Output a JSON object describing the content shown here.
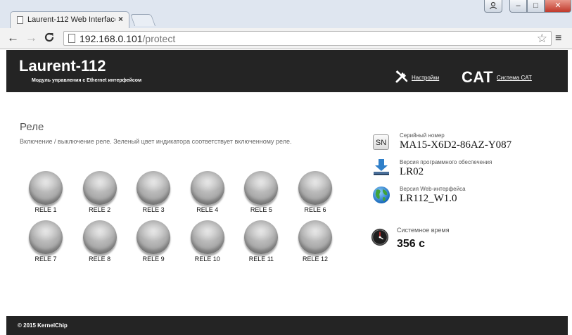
{
  "browser": {
    "tab_title": "Laurent-112 Web Interface",
    "tab_close": "×",
    "url_host": "192.168.0.101",
    "url_path": "/protect",
    "back_glyph": "←",
    "forward_glyph": "→",
    "reload_glyph": "C",
    "star_glyph": "☆",
    "menu_glyph": "≡",
    "window_buttons": {
      "user": "👤",
      "min": "–",
      "max": "□",
      "close": "✕"
    }
  },
  "header": {
    "title": "Laurent-112",
    "subtitle": "Модуль управления с Ethernet интерфейсом",
    "settings_link": "Настройки",
    "cat_logo": "CAT",
    "cat_link": "Система CAT"
  },
  "relays": {
    "title": "Реле",
    "description": "Включение / выключение реле. Зеленый цвет индикатора соответствует включенному реле.",
    "items": [
      {
        "label": "RELE 1",
        "on": false
      },
      {
        "label": "RELE 2",
        "on": false
      },
      {
        "label": "RELE 3",
        "on": false
      },
      {
        "label": "RELE 4",
        "on": false
      },
      {
        "label": "RELE 5",
        "on": false
      },
      {
        "label": "RELE 6",
        "on": false
      },
      {
        "label": "RELE 7",
        "on": false
      },
      {
        "label": "RELE 8",
        "on": false
      },
      {
        "label": "RELE 9",
        "on": false
      },
      {
        "label": "RELE 10",
        "on": false
      },
      {
        "label": "RELE 11",
        "on": false
      },
      {
        "label": "RELE 12",
        "on": false
      }
    ]
  },
  "device_info": {
    "serial_icon_text": "SN",
    "serial_label": "Серийный номер",
    "serial_value": "MA15-X6D2-86AZ-Y087",
    "firmware_label": "Версия программного обеспечения",
    "firmware_value": "LR02",
    "web_label": "Версия Web-интерфейса",
    "web_value": "LR112_W1.0",
    "time_label": "Системное время",
    "time_value": "356 с"
  },
  "footer": {
    "copyright": "© 2015 KernelChip"
  },
  "colors": {
    "header_bg": "#242424",
    "relay_off": "#a9a9a9",
    "relay_on": "#3cbf3c"
  }
}
